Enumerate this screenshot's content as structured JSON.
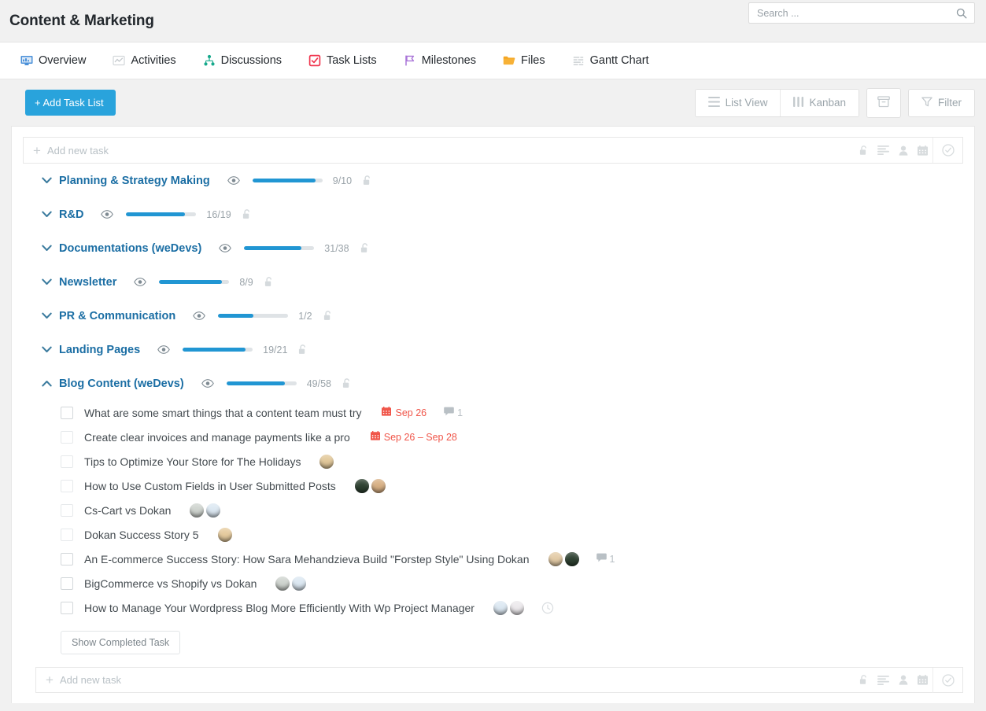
{
  "header": {
    "title": "Content & Marketing",
    "search": {
      "value": "",
      "placeholder": "Search ..."
    },
    "search_icon": "search-icon"
  },
  "tabs": [
    {
      "label": "Overview",
      "icon": "overview-monitor-icon",
      "active": true
    },
    {
      "label": "Activities",
      "icon": "activity-chart-icon",
      "active": false
    },
    {
      "label": "Discussions",
      "icon": "discussions-group-icon",
      "active": false
    },
    {
      "label": "Task Lists",
      "icon": "task-checkbox-icon",
      "active": false
    },
    {
      "label": "Milestones",
      "icon": "milestone-flag-icon",
      "active": false
    },
    {
      "label": "Files",
      "icon": "folder-icon",
      "active": false
    },
    {
      "label": "Gantt Chart",
      "icon": "gantt-bars-icon",
      "active": false
    }
  ],
  "toolbar": {
    "add_task_list_label": "+ Add Task List",
    "list_view_label": "List View",
    "kanban_label": "Kanban",
    "archive_label": "",
    "filter_label": "Filter",
    "accent_color": "#29a3dc"
  },
  "add_task_top": {
    "placeholder": "Add new task",
    "trailing_icons": [
      "lock-open-icon",
      "align-left-icon",
      "user-icon",
      "calendar-icon"
    ],
    "submit_icon": "check-circle-icon"
  },
  "add_task_bottom": {
    "placeholder": "Add new task",
    "trailing_icons": [
      "lock-open-icon",
      "align-left-icon",
      "user-icon",
      "calendar-icon"
    ],
    "submit_icon": "check-circle-icon"
  },
  "task_lists": [
    {
      "name": "Planning & Strategy Making",
      "done": 9,
      "total": 10,
      "ratio": "9/10",
      "percent": 90,
      "expanded": false
    },
    {
      "name": "R&D",
      "done": 16,
      "total": 19,
      "ratio": "16/19",
      "percent": 84,
      "expanded": false
    },
    {
      "name": "Documentations (weDevs)",
      "done": 31,
      "total": 38,
      "ratio": "31/38",
      "percent": 82,
      "expanded": false
    },
    {
      "name": "Newsletter",
      "done": 8,
      "total": 9,
      "ratio": "8/9",
      "percent": 89,
      "expanded": false
    },
    {
      "name": "PR & Communication",
      "done": 1,
      "total": 2,
      "ratio": "1/2",
      "percent": 50,
      "expanded": false
    },
    {
      "name": "Landing Pages",
      "done": 19,
      "total": 21,
      "ratio": "19/21",
      "percent": 90,
      "expanded": false
    },
    {
      "name": "Blog Content (weDevs)",
      "done": 49,
      "total": 58,
      "ratio": "49/58",
      "percent": 84,
      "expanded": true
    }
  ],
  "tasks": [
    {
      "title": "What are some smart things that a content team must try",
      "date": "Sep 26",
      "comments": "1",
      "avatars": [],
      "clock": false
    },
    {
      "title": "Create clear invoices and manage payments like a pro",
      "date": "Sep 26 – Sep 28",
      "comments": "",
      "avatars": [],
      "clock": false
    },
    {
      "title": "Tips to Optimize Your Store for The Holidays",
      "date": "",
      "comments": "",
      "avatars": [
        "#e2c89a"
      ],
      "clock": false
    },
    {
      "title": "How to Use Custom Fields in User Submitted Posts",
      "date": "",
      "comments": "",
      "avatars": [
        "#2f4232",
        "#d8b084"
      ],
      "clock": false
    },
    {
      "title": "Cs-Cart vs Dokan",
      "date": "",
      "comments": "",
      "avatars": [
        "#cfd4cf",
        "#dce8f2"
      ],
      "clock": false
    },
    {
      "title": "Dokan Success Story 5",
      "date": "",
      "comments": "",
      "avatars": [
        "#e6cb9e"
      ],
      "clock": false
    },
    {
      "title": "An E-commerce Success Story: How Sara Mehandzieva Build \"Forstep Style\" Using Dokan",
      "date": "",
      "comments": "1",
      "avatars": [
        "#e3cba6",
        "#2f4232"
      ],
      "clock": false
    },
    {
      "title": "BigCommerce vs Shopify vs Dokan",
      "date": "",
      "comments": "",
      "avatars": [
        "#cfd4cf",
        "#dce8f2"
      ],
      "clock": false
    },
    {
      "title": "How to Manage Your Wordpress Blog More Efficiently With Wp Project Manager",
      "date": "",
      "comments": "",
      "avatars": [
        "#dce8f2",
        "#ece9ec"
      ],
      "clock": true
    }
  ],
  "show_completed_label": "Show Completed Task"
}
